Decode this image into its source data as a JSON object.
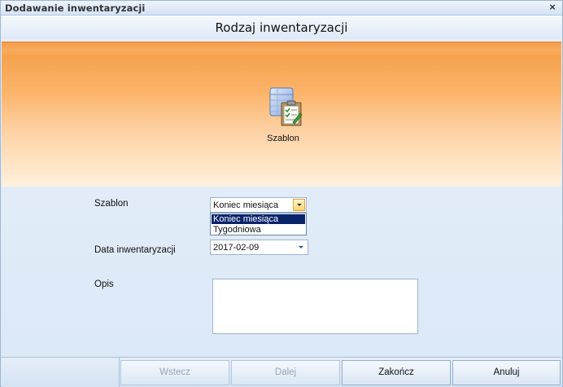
{
  "window": {
    "title": "Dodawanie inwentaryzacji",
    "close_glyph": "×"
  },
  "header": {
    "title": "Rodzaj inwentaryzacji"
  },
  "tile": {
    "label": "Szablon",
    "icon": "template-checklist-icon"
  },
  "form": {
    "szablon_label": "Szablon",
    "szablon_value": "Koniec miesiąca",
    "szablon_options": [
      "Koniec miesiąca",
      "Tygodniowa"
    ],
    "szablon_selected_index": 0,
    "data_label": "Data inwentaryzacji",
    "data_value": "2017-02-09",
    "opis_label": "Opis",
    "opis_value": ""
  },
  "footer": {
    "back_label": "Wstecz",
    "next_label": "Dalej",
    "finish_label": "Zakończ",
    "cancel_label": "Anuluj"
  },
  "colors": {
    "accent_orange": "#f7a34f",
    "selection": "#0a246a",
    "frame": "#9fb6d2"
  }
}
